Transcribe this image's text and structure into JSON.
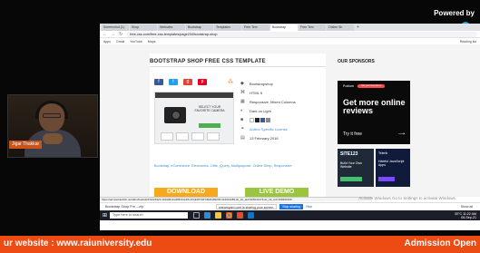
{
  "overlay": {
    "powered_by": "Powered by",
    "presenter_name": "Jigar Thakkar"
  },
  "browser": {
    "tabs": [
      {
        "label": "Screenshot (1)"
      },
      {
        "label": "Shop"
      },
      {
        "label": "Websites"
      },
      {
        "label": "Bootstrap"
      },
      {
        "label": "Templates"
      },
      {
        "label": "Free Tem"
      },
      {
        "label": "Bootstrap"
      },
      {
        "label": "Free Tem"
      },
      {
        "label": "Online Sh"
      }
    ],
    "active_tab_index": 6,
    "url": "free-css.com/free-css-templates/page234/bootstrap-shop",
    "bookmarks": [
      "Apps",
      "Gmail",
      "YouTube",
      "Maps"
    ],
    "reading_list": "Reading list"
  },
  "page": {
    "title": "BOOTSTRAP SHOP FREE CSS TEMPLATE",
    "preview": {
      "promo_text": "SELECT YOUR FAVORITE CAMERA"
    },
    "features": [
      {
        "icon": "tag-icon",
        "text": "Bootstrapshop"
      },
      {
        "icon": "code-icon",
        "text": "HTML 5"
      },
      {
        "icon": "layout-icon",
        "text": "Responsive, Mixed Columns"
      },
      {
        "icon": "contrast-icon",
        "text": "Dark on Light"
      },
      {
        "icon": "palette-icon",
        "text": ""
      },
      {
        "icon": "link-icon",
        "text": "Author Specific License"
      },
      {
        "icon": "calendar-icon",
        "text": "13 February 2016"
      }
    ],
    "swatch_colors": [
      "#ffffff",
      "#222222",
      "#3b5998",
      "#888888"
    ],
    "tags": "Bootstrap, eCommerce, Electronics, Gifts, jQuery, Multipurpose, Online Shop, Responsive",
    "download_label": "DOWNLOAD",
    "demo_label": "LIVE DEMO",
    "sponsors_heading": "OUR SPONSORS",
    "ads": {
      "ad1_brand": "Podium",
      "ad1_pill": "Get your free demo",
      "ad1_headline": "Get more online reviews",
      "ad1_cta": "Try it free",
      "ad2_site": "SITE123",
      "ad2_text": "Build Your Own Website",
      "ad3_brand": "Telerik",
      "ad3_text": "Hateful JavaScript Apps"
    },
    "status_url": "https://ad.doubleclick.net/ddm/trackclk/N1224323.1919381CARBONADS.INVENTORY/B26186296.312014285;dc_trk_aid=505011374;dc_trk_cid=158406108",
    "activate_windows": "Activate Windows\nGo to Settings to activate Windows."
  },
  "share_bar": {
    "download_file": "Bootstrap Shop Fre....zip",
    "notice": "streamyard.com is sharing your screen.",
    "stop_label": "Stop sharing",
    "hide_label": "Hide",
    "show_all": "Show all"
  },
  "taskbar": {
    "search_placeholder": "Type here to search",
    "tray_time": "11:22 AM",
    "tray_date": "06-Sep-21",
    "weather": "30°C"
  },
  "ticker": {
    "website": "ur website : www.raiuniversity.edu",
    "admission": "Admission Open"
  },
  "colors": {
    "ticker_bg": "#ec4b14",
    "download_btn": "#f7a81b",
    "demo_btn": "#9bc53d",
    "link_blue": "#3b8fd1"
  }
}
